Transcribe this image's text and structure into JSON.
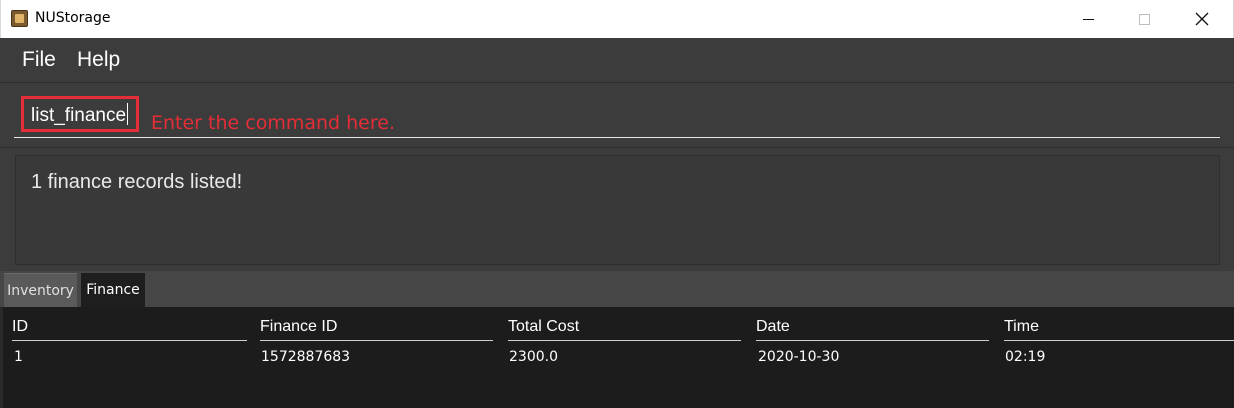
{
  "window": {
    "title": "NUStorage",
    "icon": "app-icon"
  },
  "menu": {
    "items": [
      {
        "label": "File"
      },
      {
        "label": "Help"
      }
    ]
  },
  "command": {
    "value": "list_finance",
    "hint": "Enter the command here.",
    "highlight_color": "#e52d38"
  },
  "result": {
    "message": "1 finance records listed!"
  },
  "tabs": [
    {
      "label": "Inventory",
      "selected": false
    },
    {
      "label": "Finance",
      "selected": true
    }
  ],
  "table": {
    "columns": [
      "ID",
      "Finance ID",
      "Total Cost",
      "Date",
      "Time"
    ],
    "rows": [
      [
        "1",
        "1572887683",
        "2300.0",
        "2020-10-30",
        "02:19"
      ]
    ]
  }
}
